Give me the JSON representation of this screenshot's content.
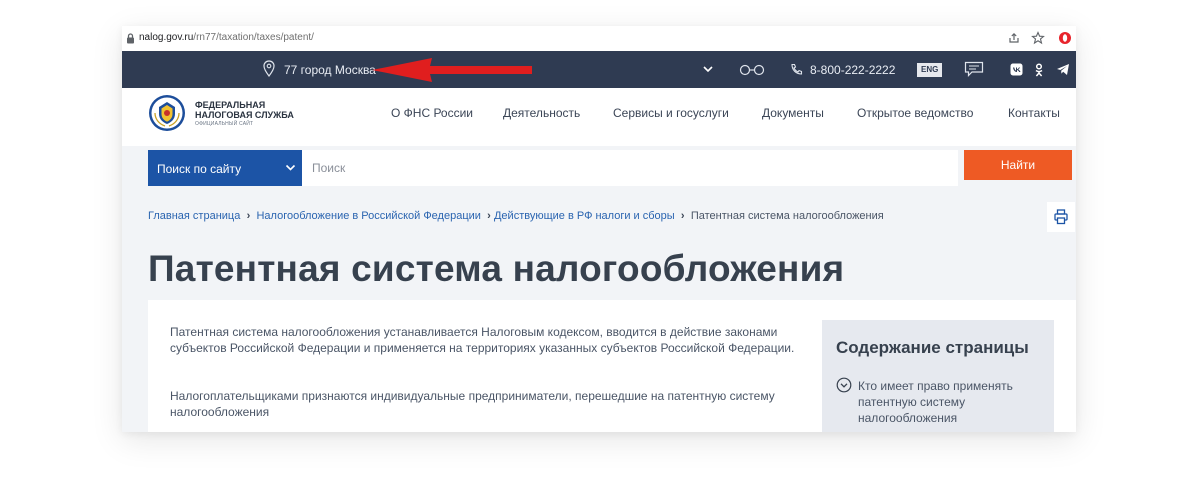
{
  "browser": {
    "url_domain": "nalog.gov.ru",
    "url_path": "/rn77/taxation/taxes/patent/",
    "icons": [
      "lock-icon",
      "share-icon",
      "star-icon",
      "opera-icon"
    ]
  },
  "topbar": {
    "city": "77 город Москва",
    "phone": "8-800-222-2222",
    "lang": "ENG",
    "colors": {
      "background": "#2f3b52",
      "arrow": "#e01e1e"
    }
  },
  "header": {
    "logo": {
      "line1": "ФЕДЕРАЛЬНАЯ",
      "line2": "НАЛОГОВАЯ СЛУЖБА",
      "line3": "ОФИЦИАЛЬНЫЙ САЙТ"
    },
    "nav": [
      {
        "label": "О ФНС России"
      },
      {
        "label": "Деятельность"
      },
      {
        "label": "Сервисы и госуслуги"
      },
      {
        "label": "Документы"
      },
      {
        "label": "Открытое ведомство"
      },
      {
        "label": "Контакты"
      }
    ]
  },
  "search": {
    "scope": "Поиск по сайту",
    "placeholder": "Поиск",
    "button": "Найти",
    "colors": {
      "scope": "#1c54a6",
      "button": "#ee5a24"
    }
  },
  "breadcrumbs": [
    {
      "label": "Главная страница"
    },
    {
      "label": "Налогообложение в Российской Федерации"
    },
    {
      "label": "Действующие в РФ налоги и сборы"
    },
    {
      "label": "Патентная система налогообложения"
    }
  ],
  "page": {
    "title": "Патентная система налогообложения",
    "paragraphs": [
      "Патентная система налогообложения устанавливается Налоговым кодексом, вводится в действие законами субъектов Российской Федерации и применяется на территориях указанных субъектов Российской Федерации.",
      "Налогоплательщиками признаются индивидуальные предприниматели, перешедшие на патентную систему налогообложения"
    ]
  },
  "toc": {
    "title": "Содержание страницы",
    "items": [
      {
        "label": "Кто имеет право применять патентную систему налогообложения"
      }
    ]
  }
}
